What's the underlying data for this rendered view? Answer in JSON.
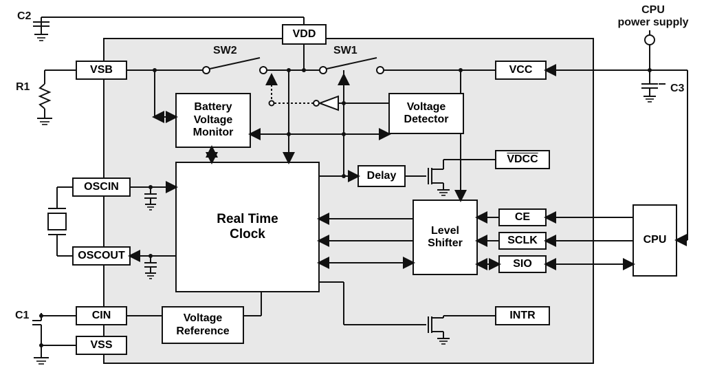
{
  "diagram": {
    "title": "Real-Time Clock IC block diagram",
    "externals": {
      "c1": "C1",
      "c2": "C2",
      "c3": "C3",
      "r1": "R1",
      "cpu_supply": "CPU\npower supply",
      "cpu": "CPU"
    },
    "pins": {
      "vdd": "VDD",
      "vsb": "VSB",
      "vcc": "VCC",
      "vdcc": "VDCC",
      "oscin": "OSCIN",
      "oscout": "OSCOUT",
      "cin": "CIN",
      "vss": "VSS",
      "ce": "CE",
      "sclk": "SCLK",
      "sio": "SIO",
      "intr": "INTR"
    },
    "switches": {
      "sw1": "SW1",
      "sw2": "SW2"
    },
    "blocks": {
      "battery_monitor": "Battery\nVoltage\nMonitor",
      "voltage_detector": "Voltage\nDetector",
      "delay": "Delay",
      "rtc": "Real Time\nClock",
      "level_shifter": "Level\nShifter",
      "voltage_reference": "Voltage\nReference"
    }
  },
  "chart_data": {
    "type": "table",
    "title": "RTC IC block diagram — blocks and connections",
    "blocks": [
      {
        "id": "vdd",
        "kind": "pin",
        "label": "VDD"
      },
      {
        "id": "vsb",
        "kind": "pin",
        "label": "VSB"
      },
      {
        "id": "vcc",
        "kind": "pin",
        "label": "VCC"
      },
      {
        "id": "vdcc",
        "kind": "pin",
        "label": "VDCC (active-low)"
      },
      {
        "id": "oscin",
        "kind": "pin",
        "label": "OSCIN"
      },
      {
        "id": "oscout",
        "kind": "pin",
        "label": "OSCOUT"
      },
      {
        "id": "cin",
        "kind": "pin",
        "label": "CIN"
      },
      {
        "id": "vss",
        "kind": "pin",
        "label": "VSS"
      },
      {
        "id": "ce",
        "kind": "pin",
        "label": "CE"
      },
      {
        "id": "sclk",
        "kind": "pin",
        "label": "SCLK"
      },
      {
        "id": "sio",
        "kind": "pin",
        "label": "SIO"
      },
      {
        "id": "intr",
        "kind": "pin",
        "label": "INTR"
      },
      {
        "id": "sw1",
        "kind": "switch",
        "label": "SW1"
      },
      {
        "id": "sw2",
        "kind": "switch",
        "label": "SW2"
      },
      {
        "id": "bvm",
        "kind": "block",
        "label": "Battery Voltage Monitor"
      },
      {
        "id": "vdet",
        "kind": "block",
        "label": "Voltage Detector"
      },
      {
        "id": "delay",
        "kind": "block",
        "label": "Delay"
      },
      {
        "id": "rtc",
        "kind": "block",
        "label": "Real Time Clock"
      },
      {
        "id": "lvl",
        "kind": "block",
        "label": "Level Shifter"
      },
      {
        "id": "vref",
        "kind": "block",
        "label": "Voltage Reference"
      },
      {
        "id": "cpu",
        "kind": "external",
        "label": "CPU"
      },
      {
        "id": "cpu_supply",
        "kind": "external",
        "label": "CPU power supply"
      },
      {
        "id": "c1",
        "kind": "external",
        "label": "C1 capacitor to GND"
      },
      {
        "id": "c2",
        "kind": "external",
        "label": "C2 capacitor to GND"
      },
      {
        "id": "c3",
        "kind": "external",
        "label": "C3 capacitor to GND"
      },
      {
        "id": "r1",
        "kind": "external",
        "label": "R1 resistor to GND"
      },
      {
        "id": "xtal",
        "kind": "external",
        "label": "Crystal between OSCIN and OSCOUT"
      }
    ],
    "edges": [
      {
        "from": "c2",
        "to": "vdd",
        "dir": "none"
      },
      {
        "from": "vdd",
        "to": "sw2",
        "via": "line",
        "dir": "none"
      },
      {
        "from": "vsb",
        "to": "sw2",
        "dir": "none"
      },
      {
        "from": "sw2",
        "to": "sw1",
        "dir": "none"
      },
      {
        "from": "sw1",
        "to": "vcc",
        "dir": "none"
      },
      {
        "from": "vcc",
        "to": "cpu_supply",
        "dir": "from"
      },
      {
        "from": "cpu_supply",
        "to": "c3",
        "dir": "none"
      },
      {
        "from": "cpu_supply",
        "to": "cpu",
        "dir": "to"
      },
      {
        "from": "r1",
        "to": "vsb",
        "dir": "none"
      },
      {
        "from": "vsb",
        "to": "bvm",
        "dir": "both",
        "note": "via SW2 branch"
      },
      {
        "from": "vdet",
        "to": "sw1",
        "dir": "to",
        "note": "control via inverter, dotted"
      },
      {
        "from": "vdet",
        "to": "sw2",
        "dir": "to",
        "note": "control via inverter, dotted"
      },
      {
        "from": "vdet",
        "to": "vcc",
        "dir": "from",
        "note": "sense"
      },
      {
        "from": "vdd",
        "via": "rail",
        "to": "rtc",
        "dir": "to"
      },
      {
        "from": "rtc",
        "to": "bvm",
        "dir": "both"
      },
      {
        "from": "rtc",
        "to": "vdet",
        "dir": "both"
      },
      {
        "from": "rtc",
        "to": "delay",
        "dir": "to"
      },
      {
        "from": "delay",
        "to": "mosfet1",
        "dir": "to",
        "note": "open-drain to VDCC"
      },
      {
        "from": "mosfet1",
        "to": "vdcc",
        "dir": "none"
      },
      {
        "from": "rtc",
        "to": "lvl",
        "dir": "both"
      },
      {
        "from": "lvl",
        "to": "ce",
        "dir": "from"
      },
      {
        "from": "lvl",
        "to": "sclk",
        "dir": "from"
      },
      {
        "from": "lvl",
        "to": "sio",
        "dir": "both"
      },
      {
        "from": "lvl",
        "to": "vcc",
        "dir": "from"
      },
      {
        "from": "ce",
        "to": "cpu",
        "dir": "from"
      },
      {
        "from": "sclk",
        "to": "cpu",
        "dir": "from"
      },
      {
        "from": "sio",
        "to": "cpu",
        "dir": "both"
      },
      {
        "from": "rtc",
        "to": "mosfet2",
        "dir": "to",
        "note": "open-drain to INTR"
      },
      {
        "from": "mosfet2",
        "to": "intr",
        "dir": "none"
      },
      {
        "from": "oscin",
        "to": "rtc",
        "dir": "to"
      },
      {
        "from": "rtc",
        "to": "oscout",
        "dir": "to"
      },
      {
        "from": "xtal",
        "to": "oscin",
        "dir": "none"
      },
      {
        "from": "xtal",
        "to": "oscout",
        "dir": "none"
      },
      {
        "from": "c1",
        "to": "cin",
        "dir": "none"
      },
      {
        "from": "cin",
        "to": "vref",
        "dir": "none"
      },
      {
        "from": "vref",
        "to": "rtc",
        "dir": "none"
      },
      {
        "from": "vss",
        "to": "gnd",
        "dir": "none"
      }
    ]
  }
}
